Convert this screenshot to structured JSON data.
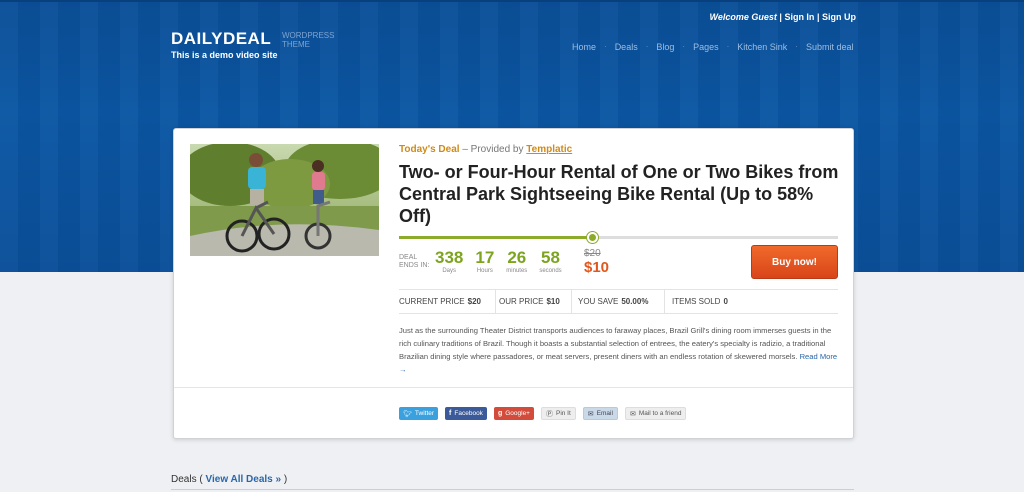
{
  "site": {
    "logo": "DAILYDEAL",
    "logo_sub": "WORDPRESS THEME",
    "tagline": "This is a demo video site"
  },
  "user_links": {
    "welcome": "Welcome Guest",
    "sign_in": "Sign In",
    "sign_up": "Sign Up",
    "separator": "|"
  },
  "nav": {
    "items": [
      "Home",
      "Deals",
      "Blog",
      "Pages",
      "Kitchen Sink",
      "Submit deal"
    ],
    "separator": "·"
  },
  "deal": {
    "label": "Today's Deal",
    "provided_prefix": "– Provided by",
    "provider": "Templatic",
    "title": "Two- or Four-Hour Rental of One or Two Bikes from Central Park Sightseeing Bike Rental (Up to 58% Off)",
    "progress_fraction": 0.44,
    "ends_in_label": "DEAL ENDS IN:",
    "countdown": [
      {
        "value": "338",
        "label": "Days"
      },
      {
        "value": "17",
        "label": "Hours"
      },
      {
        "value": "26",
        "label": "minutes"
      },
      {
        "value": "58",
        "label": "seconds"
      }
    ],
    "old_price": "$20",
    "new_price": "$10",
    "buy_label": "Buy now!",
    "stats": [
      {
        "label": "CURRENT PRICE",
        "value": "$20"
      },
      {
        "label": "OUR PRICE",
        "value": "$10"
      },
      {
        "label": "YOU SAVE",
        "value": "50.00%"
      },
      {
        "label": "ITEMS SOLD",
        "value": "0"
      }
    ],
    "description": "Just as the surrounding Theater District transports audiences to faraway places, Brazil Grill's dining room immerses guests in the rich culinary traditions of Brazil. Though it boasts a substantial selection of entrees, the eatery's specialty is radizio, a traditional Brazilian dining style where passadores, or meat servers, present diners with an endless rotation of skewered morsels.",
    "read_more": "Read More →"
  },
  "share": {
    "twitter": "Twitter",
    "facebook": "Facebook",
    "google": "Google+",
    "pin": "Pin It",
    "email": "Email",
    "friend": "Mail to a friend"
  },
  "deals_section": {
    "title": "Deals",
    "open": "(",
    "view_all": "View All Deals »",
    "close": ")"
  },
  "colors": {
    "header_blue": "#0b56a3",
    "accent_orange": "#e0581f",
    "countdown_green": "#7da41f",
    "deal_label_gold": "#d08a17"
  }
}
